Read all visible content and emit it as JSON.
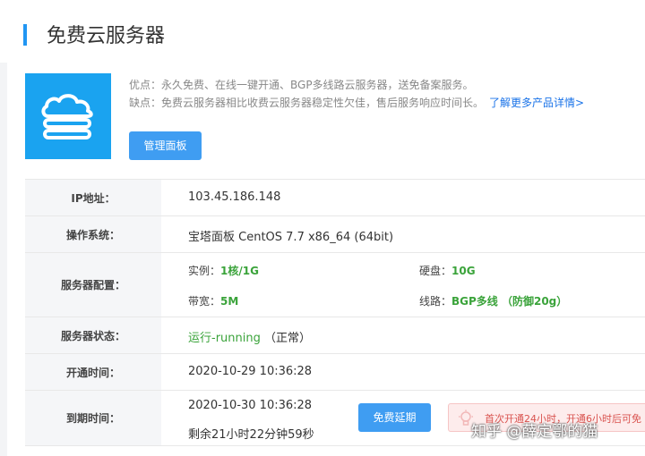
{
  "header": {
    "title": "免费云服务器"
  },
  "product": {
    "desc_line1": "优点：永久免费、在线一键开通、BGP多线路云服务器，送免备案服务。",
    "desc_line2": "缺点：免费云服务器相比收费云服务器稳定性欠佳，售后服务响应时间长。",
    "more_link": "了解更多产品详情>",
    "manage_button": "管理面板"
  },
  "info": {
    "ip": {
      "label": "IP地址：",
      "value": "103.45.186.148"
    },
    "os": {
      "label": "操作系统：",
      "value": "宝塔面板 CentOS 7.7 x86_64 (64bit)"
    },
    "config": {
      "label": "服务器配置：",
      "instance_key": "实例：",
      "instance_val": "1核/1G",
      "disk_key": "硬盘：",
      "disk_val": "10G",
      "bandwidth_key": "带宽：",
      "bandwidth_val": "5M",
      "line_key": "线路：",
      "line_val": "BGP多线 （防御20g）"
    },
    "status": {
      "label": "服务器状态：",
      "value": "运行-running",
      "note": "（正常）"
    },
    "open_time": {
      "label": "开通时间：",
      "value": "2020-10-29 10:36:28"
    },
    "expire": {
      "label": "到期时间：",
      "value": "2020-10-30 10:36:28",
      "remaining": "剩余21小时22分钟59秒",
      "renew_button": "免费延期",
      "notice": "首次开通24小时，开通6小时后可免"
    }
  },
  "watermark": "知乎 @薛定鄂的猫",
  "colors": {
    "accent": "#2196f3",
    "button": "#3f9df2",
    "green": "#3aa33a",
    "red": "#d9231d"
  }
}
